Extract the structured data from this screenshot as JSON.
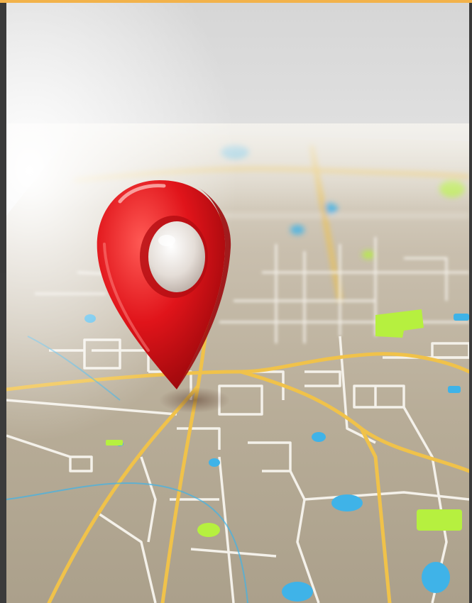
{
  "image": {
    "subject": "red-location-pin-on-city-map",
    "colors": {
      "accent": "#f2b24a",
      "frame": "#3b3b3b",
      "map_ground": "#b9ad98",
      "road_white": "#f4f1ea",
      "road_yellow": "#f0c24a",
      "water_blue": "#3fb3e8",
      "park_green": "#b6f03f",
      "pin_red": "#e0141a",
      "pin_center": "#e8e2dc"
    }
  }
}
